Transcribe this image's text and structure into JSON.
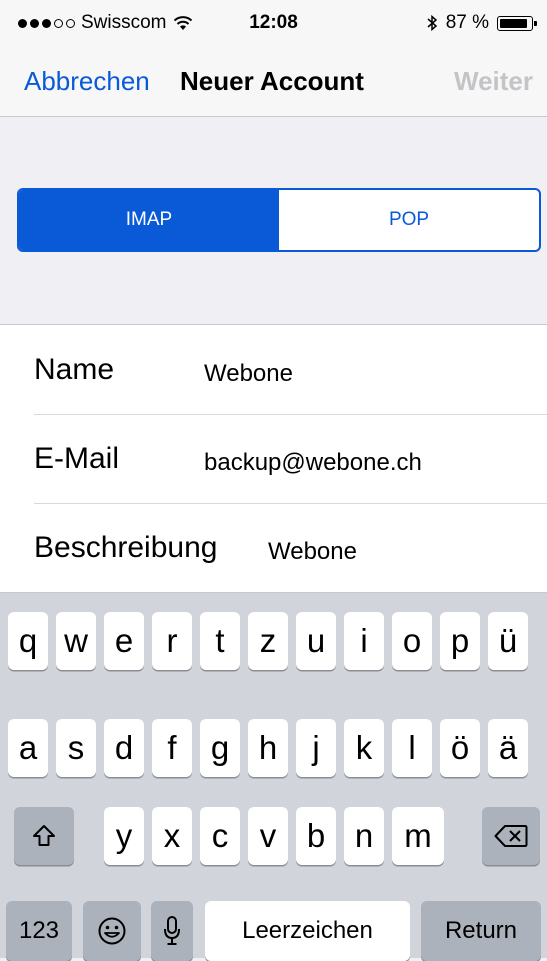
{
  "status_bar": {
    "signal_dots": 5,
    "signal_filled": 3,
    "carrier": "Swisscom",
    "time": "12:08",
    "battery_percent": "87 %",
    "battery_level": 0.87
  },
  "nav": {
    "cancel": "Abbrechen",
    "title": "Neuer Account",
    "next": "Weiter"
  },
  "segmented": {
    "options": [
      "IMAP",
      "POP"
    ],
    "selected": "IMAP"
  },
  "form": [
    {
      "label": "Name",
      "value": "Webone"
    },
    {
      "label": "E-Mail",
      "value": "backup@webone.ch"
    },
    {
      "label": "Beschreibung",
      "value": "Webone"
    }
  ],
  "keyboard": {
    "row1": [
      "q",
      "w",
      "e",
      "r",
      "t",
      "z",
      "u",
      "i",
      "o",
      "p",
      "ü"
    ],
    "row2": [
      "a",
      "s",
      "d",
      "f",
      "g",
      "h",
      "j",
      "k",
      "l",
      "ö",
      "ä"
    ],
    "row3": [
      "y",
      "x",
      "c",
      "v",
      "b",
      "n",
      "m"
    ],
    "numbers": "123",
    "space": "Leerzeichen",
    "return": "Return",
    "icons": [
      "shift-icon",
      "backspace-icon",
      "emoji-icon",
      "microphone-icon"
    ]
  },
  "colors": {
    "accent": "#0a5ad8",
    "disabled": "#c4c4c8",
    "keyboard_bg": "#d1d5db",
    "dark_key": "#abb2bb"
  }
}
